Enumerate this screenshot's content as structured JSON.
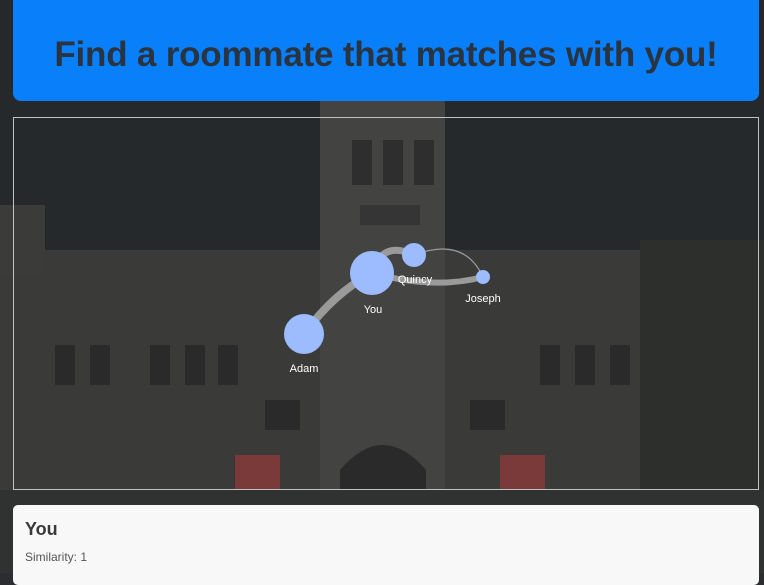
{
  "header": {
    "title": "Find a roommate that matches with you!"
  },
  "graph": {
    "nodes": [
      {
        "id": "you",
        "label": "You"
      },
      {
        "id": "adam",
        "label": "Adam"
      },
      {
        "id": "quincy",
        "label": "Quincy"
      },
      {
        "id": "joseph",
        "label": "Joseph"
      }
    ],
    "colors": {
      "node": "#9cbcff",
      "link": "#9a9a9a",
      "label": "#ffffff"
    }
  },
  "details": {
    "name": "You",
    "similarity_label": "Similarity:",
    "similarity_value": "1"
  }
}
